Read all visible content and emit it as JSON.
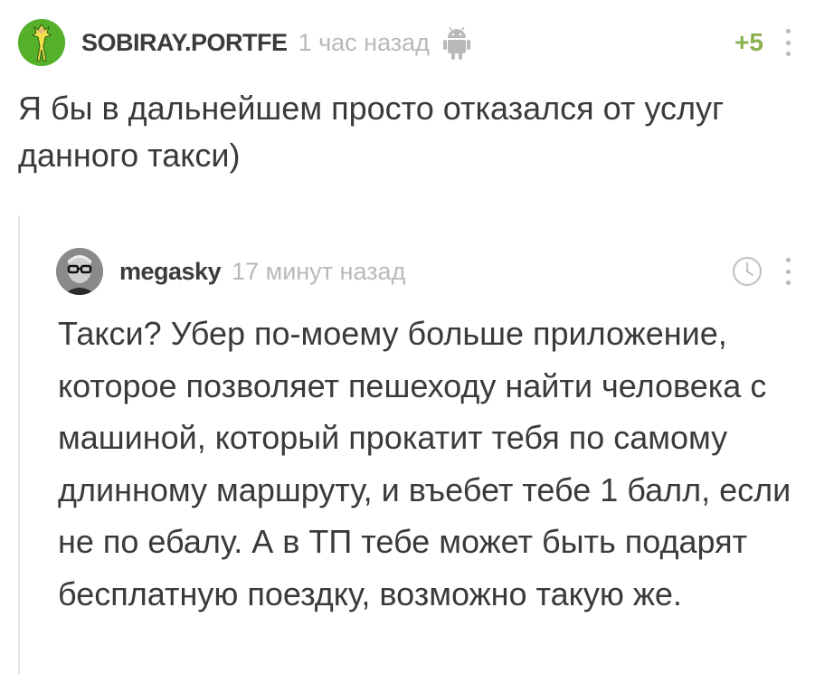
{
  "comment": {
    "username": "SOBIRAY.PORTFE",
    "time": "1 час назад",
    "device_icon": "android-icon",
    "rating": "+5",
    "text": "Я бы в дальнейшем просто отказался от услуг данного такси)"
  },
  "reply": {
    "username": "megasky",
    "time": "17 минут назад",
    "action_icon": "clock-icon",
    "text": "Такси? Убер по-моему больше приложение, которое позволяет пешеходу найти человека с машиной, который прокатит тебя по самому длинному маршруту, и въебет тебе 1 балл, если не по ебалу. А в ТП тебе может быть подарят бесплатную поездку, возможно такую же."
  },
  "colors": {
    "rating": "#8ab34f",
    "muted": "#b9b9b9",
    "text": "#3a3a3a"
  }
}
